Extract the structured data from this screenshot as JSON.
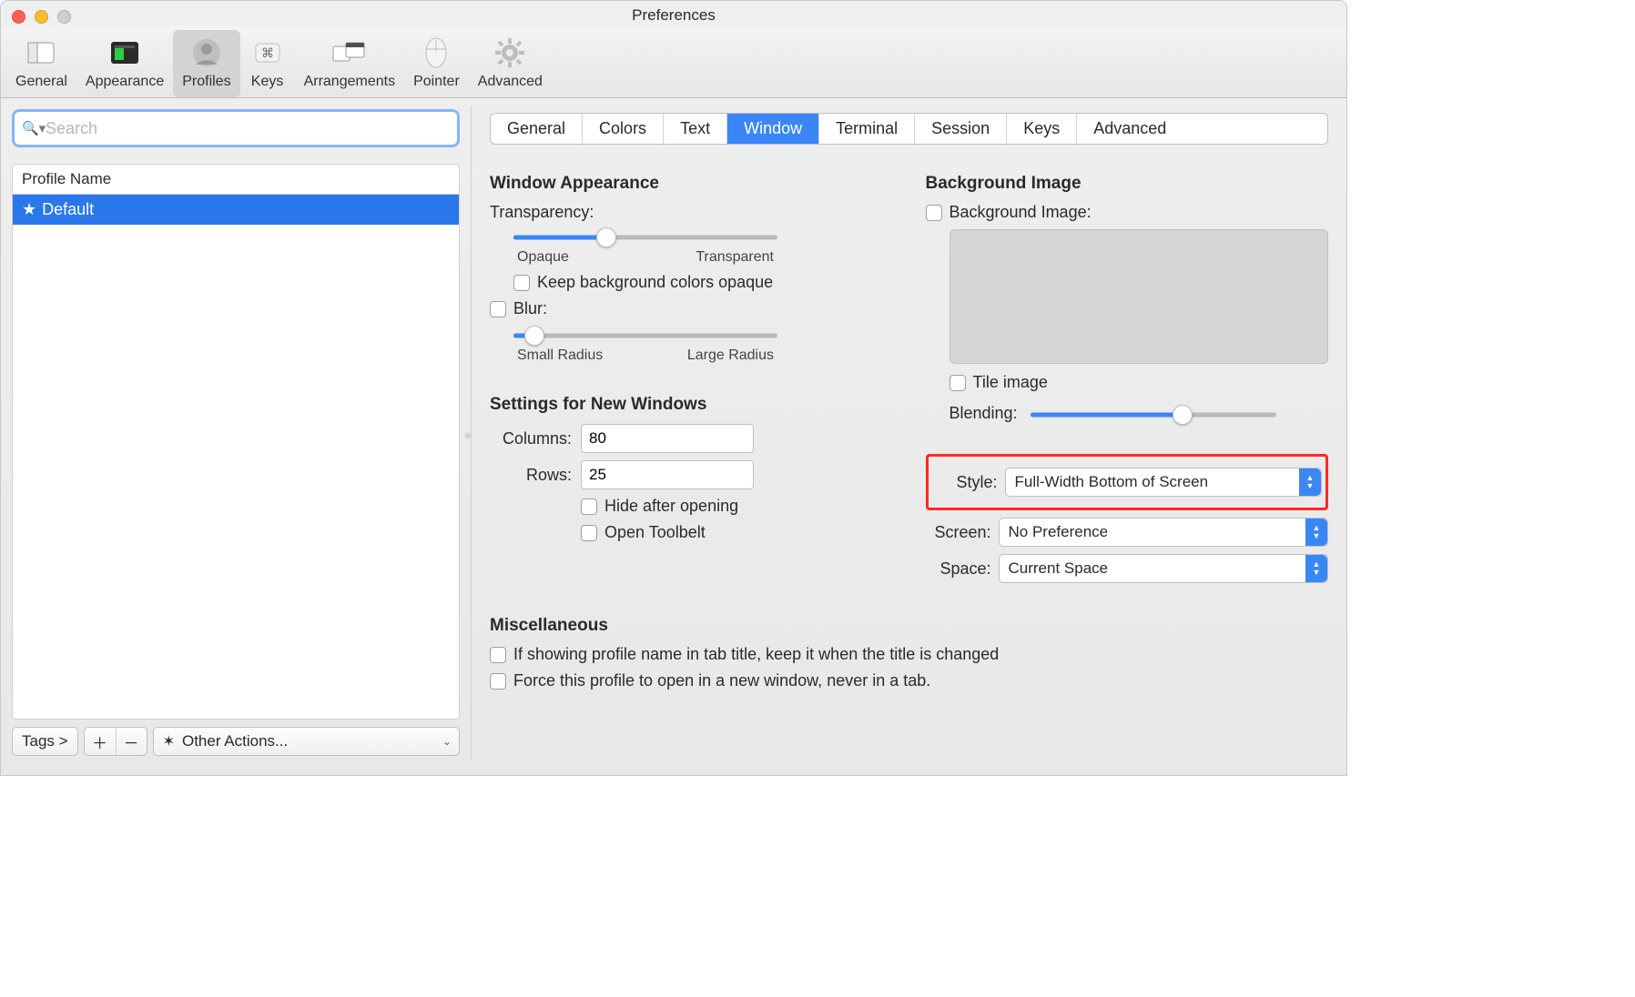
{
  "window": {
    "title": "Preferences"
  },
  "toolbar": {
    "items": [
      {
        "label": "General"
      },
      {
        "label": "Appearance"
      },
      {
        "label": "Profiles"
      },
      {
        "label": "Keys"
      },
      {
        "label": "Arrangements"
      },
      {
        "label": "Pointer"
      },
      {
        "label": "Advanced"
      }
    ],
    "selected_index": 2
  },
  "left": {
    "search_placeholder": "Search",
    "profile_header": "Profile Name",
    "profiles": [
      {
        "name": "Default",
        "starred": true,
        "selected": true
      }
    ],
    "tags_button": "Tags >",
    "other_actions": "Other Actions..."
  },
  "tabs": {
    "items": [
      "General",
      "Colors",
      "Text",
      "Window",
      "Terminal",
      "Session",
      "Keys",
      "Advanced"
    ],
    "selected_index": 3
  },
  "appearance": {
    "heading": "Window Appearance",
    "transparency_label": "Transparency:",
    "transparency_min": "Opaque",
    "transparency_max": "Transparent",
    "transparency_value_pct": 35,
    "keep_bg_opaque": "Keep background colors opaque",
    "blur_label": "Blur:",
    "blur_min": "Small Radius",
    "blur_max": "Large Radius",
    "blur_value_pct": 8
  },
  "new_windows": {
    "heading": "Settings for New Windows",
    "columns_label": "Columns:",
    "columns_value": "80",
    "rows_label": "Rows:",
    "rows_value": "25",
    "hide_after_opening": "Hide after opening",
    "open_toolbelt": "Open Toolbelt"
  },
  "bg_image": {
    "heading": "Background Image",
    "checkbox_label": "Background Image:",
    "tile_label": "Tile image",
    "blending_label": "Blending:",
    "blending_value_pct": 62
  },
  "placement": {
    "style_label": "Style:",
    "style_value": "Full-Width Bottom of Screen",
    "screen_label": "Screen:",
    "screen_value": "No Preference",
    "space_label": "Space:",
    "space_value": "Current Space"
  },
  "misc": {
    "heading": "Miscellaneous",
    "keep_profile_name": "If showing profile name in tab title, keep it when the title is changed",
    "force_new_window": "Force this profile to open in a new window, never in a tab."
  }
}
